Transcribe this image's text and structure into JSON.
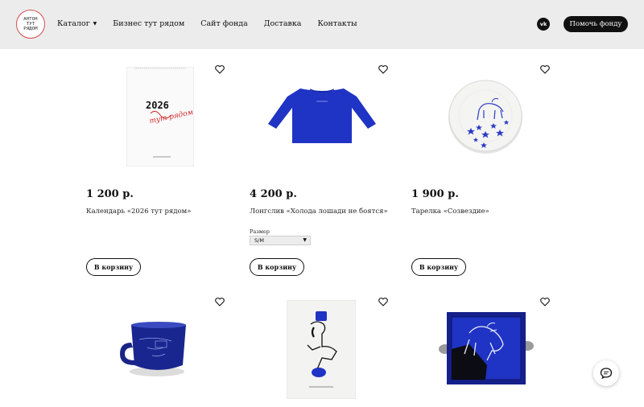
{
  "header": {
    "logo_text": "АНТОН ТУТ РЯДОМ",
    "nav": [
      {
        "label": "Каталог",
        "dropdown": true
      },
      {
        "label": "Бизнес тут рядом"
      },
      {
        "label": "Сайт фонда"
      },
      {
        "label": "Доставка"
      },
      {
        "label": "Контакты"
      }
    ],
    "vk_label": "vk",
    "help_button": "Помочь фонду"
  },
  "products": [
    {
      "price": "1 200 р.",
      "name": "Календарь «2026 тут рядом»",
      "cart_label": "В корзину",
      "image": "calendar-image",
      "calendar_year": "2026",
      "calendar_script": "тут рядом"
    },
    {
      "price": "4 200 р.",
      "name": "Лонгслив «Холода лошади не боятся»",
      "cart_label": "В корзину",
      "image": "longsleeve-image",
      "size_label": "Размер",
      "size_value": "S/M"
    },
    {
      "price": "1 900 р.",
      "name": "Тарелка «Созвездие»",
      "cart_label": "В корзину",
      "image": "plate-image"
    },
    {
      "image": "mug-image"
    },
    {
      "image": "poster-image"
    },
    {
      "image": "tray-image"
    }
  ],
  "colors": {
    "header_bg": "#ececec",
    "accent_blue": "#1f33c4",
    "logo_red": "#d94a4a",
    "button_dark": "#111111"
  },
  "chat_icon": "chat-bubble-icon"
}
